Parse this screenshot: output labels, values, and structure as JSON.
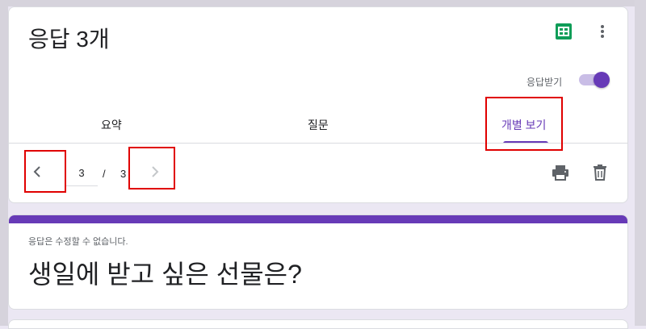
{
  "header": {
    "title": "응답 3개",
    "accept_responses_label": "응답받기",
    "accept_responses_on": true
  },
  "tabs": [
    {
      "label": "요약"
    },
    {
      "label": "질문"
    },
    {
      "label": "개별 보기",
      "active": true
    }
  ],
  "navigation": {
    "current_page": "3",
    "separator": "/",
    "total_pages": "3"
  },
  "form": {
    "notice": "응답은 수정할 수 없습니다.",
    "title": "생일에 받고 싶은 선물은?"
  },
  "colors": {
    "accent": "#673ab7",
    "sheets_green": "#0f9d58",
    "highlight": "#e00000"
  },
  "icons": {
    "sheets": "sheets-icon",
    "more": "more-vert-icon",
    "prev": "chevron-left-icon",
    "next": "chevron-right-icon",
    "print": "print-icon",
    "delete": "delete-icon"
  }
}
